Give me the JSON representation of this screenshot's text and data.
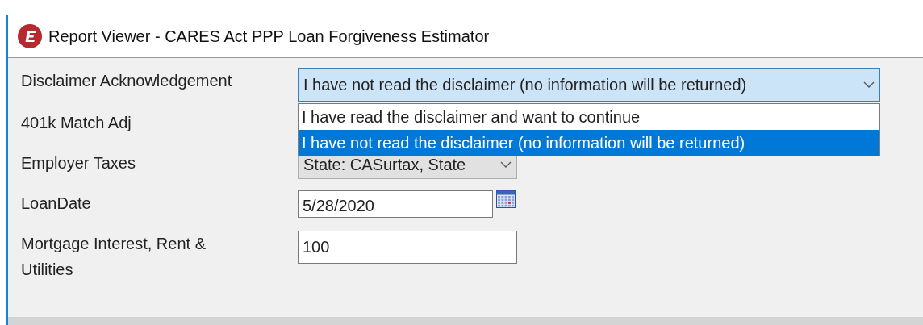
{
  "window": {
    "title": "Report Viewer - CARES Act PPP Loan Forgiveness Estimator"
  },
  "fields": [
    {
      "label": "Disclaimer Acknowledgement",
      "kind": "dropdown",
      "value": "I have not read the disclaimer (no information will be returned)",
      "expanded": true,
      "options": [
        {
          "label": "I have read the disclaimer and want to continue",
          "selected": false
        },
        {
          "label": "I have not read the disclaimer (no information will be returned)",
          "selected": true
        }
      ]
    },
    {
      "label": "401k Match Adj",
      "kind": "hidden"
    },
    {
      "label": "Employer Taxes",
      "kind": "select",
      "value": "State: CASurtax, State"
    },
    {
      "label": "LoanDate",
      "kind": "date",
      "value": "5/28/2020"
    },
    {
      "label": "Mortgage Interest, Rent & Utilities",
      "kind": "text",
      "value": "100"
    }
  ]
}
